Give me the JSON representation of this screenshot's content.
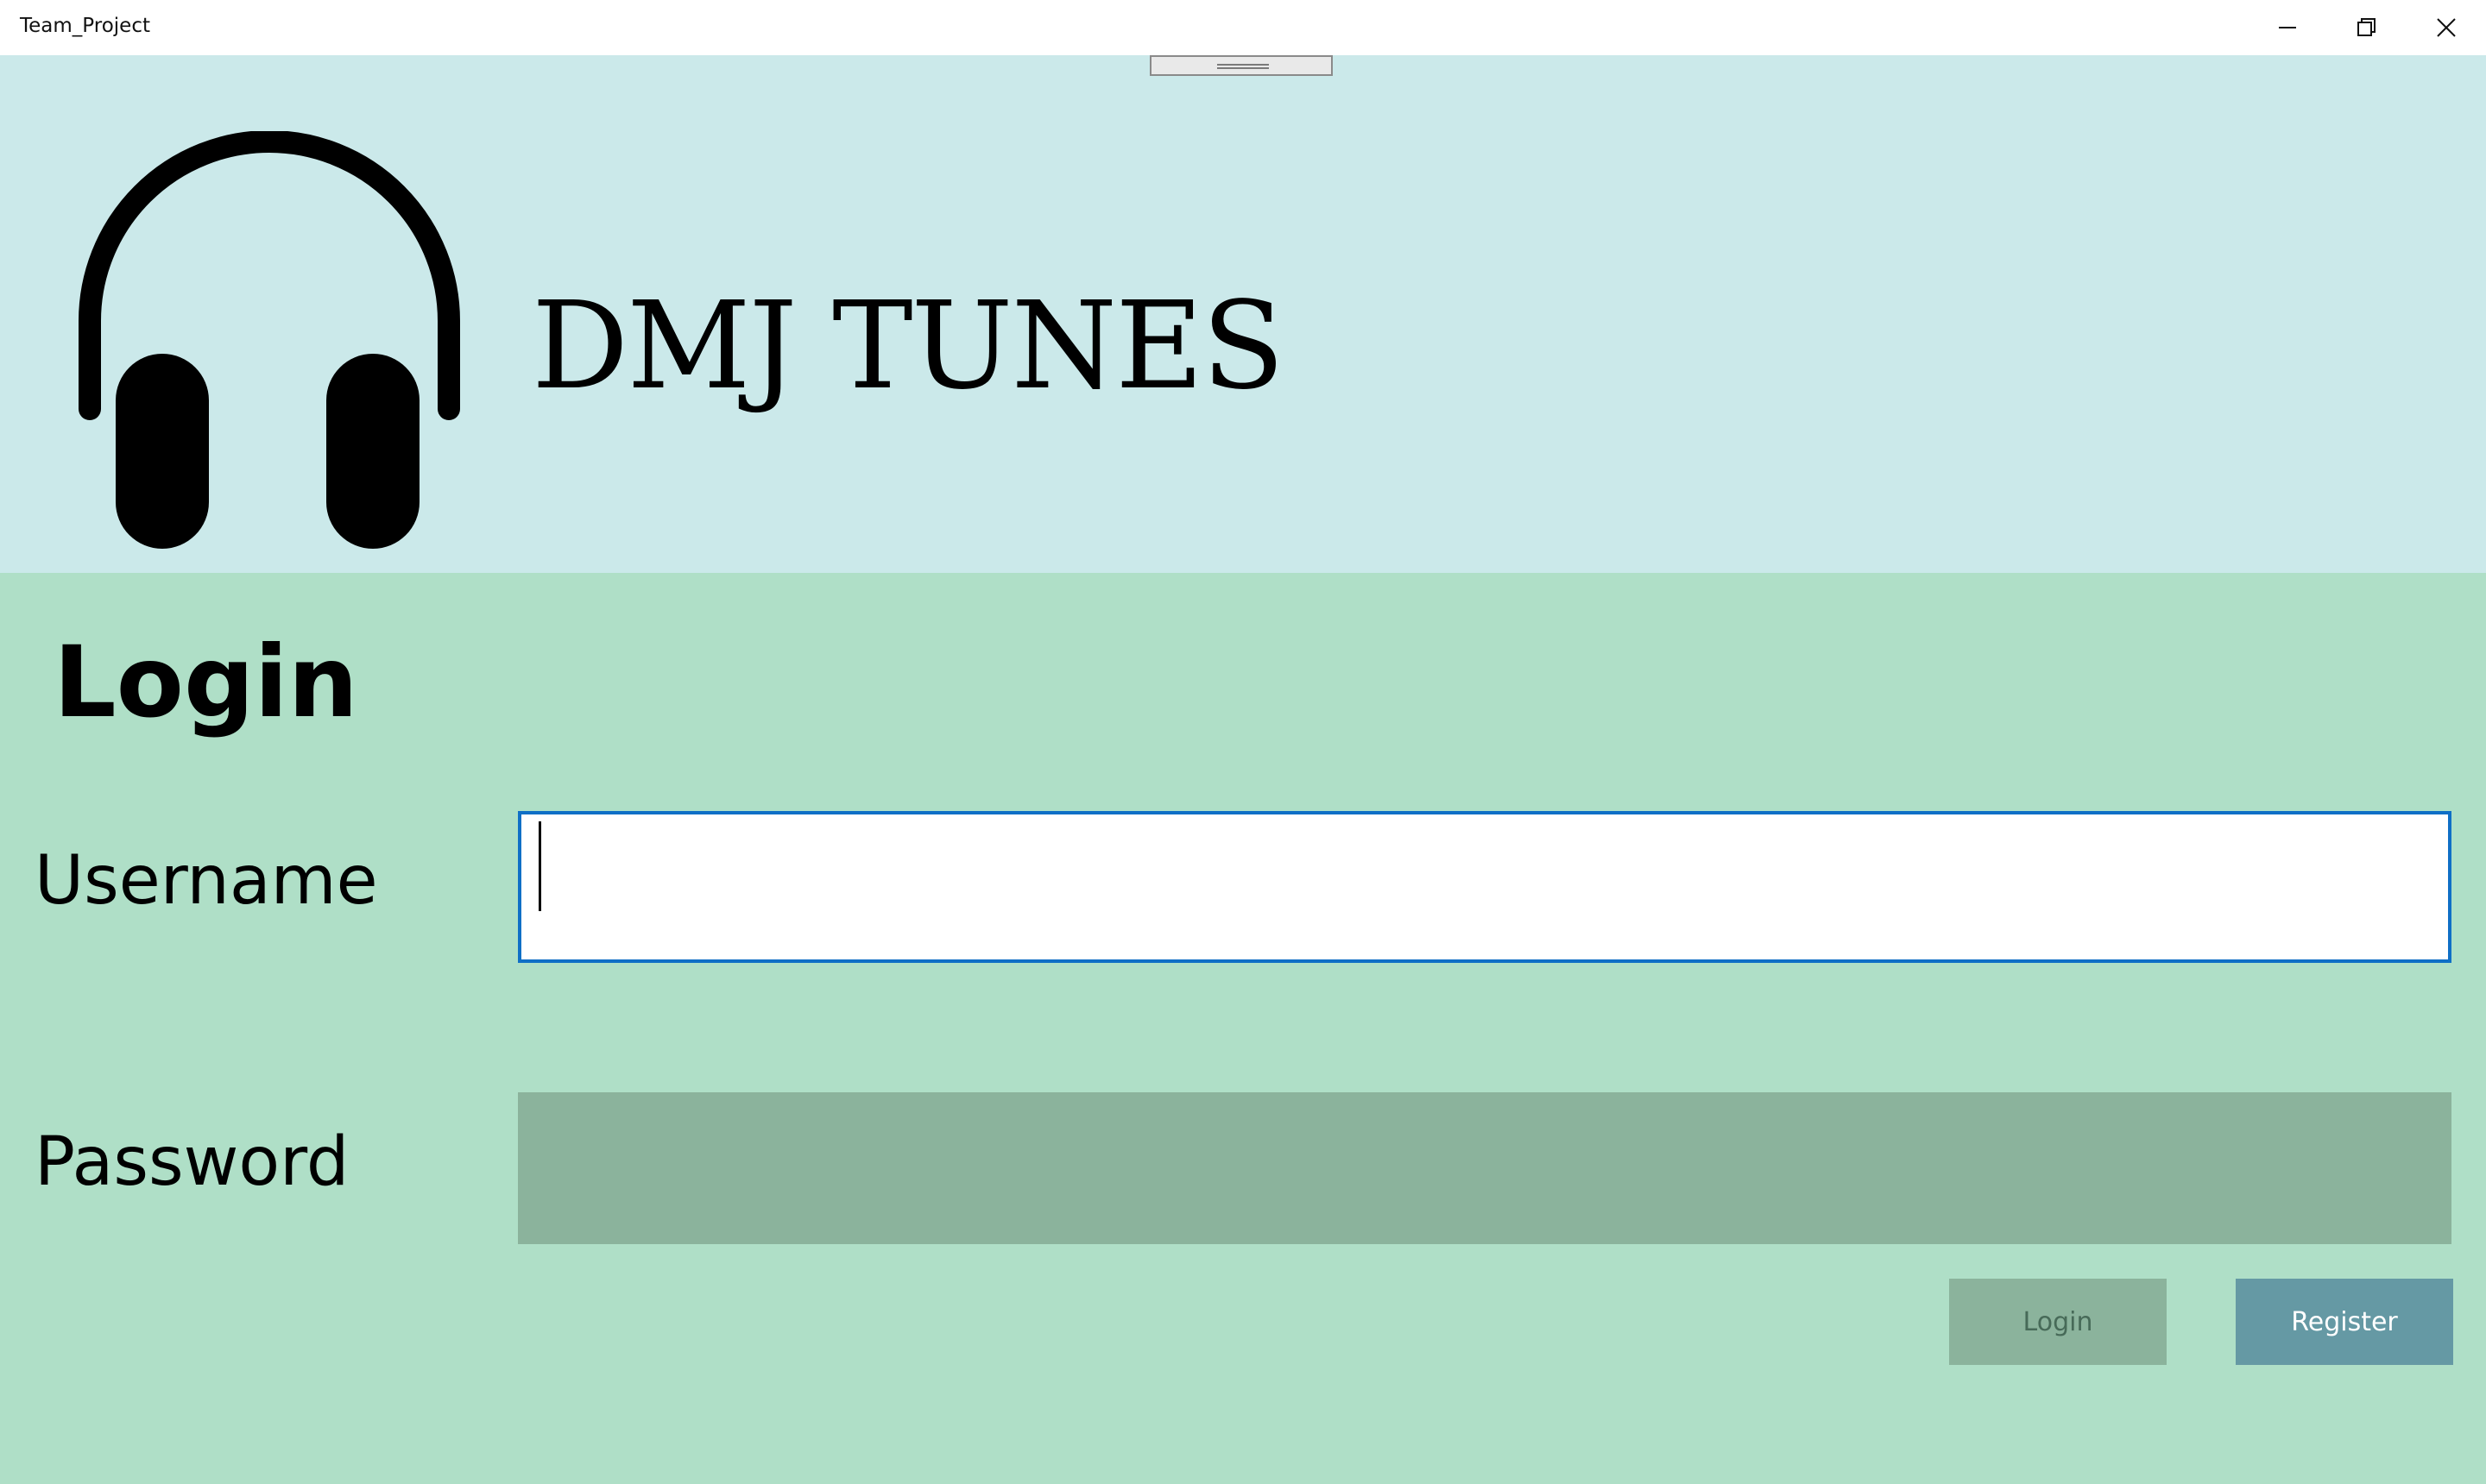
{
  "window": {
    "title": "Team_Project"
  },
  "header": {
    "brand": "DMJ TUNES",
    "logo_icon": "headphones-icon"
  },
  "login": {
    "heading": "Login",
    "username_label": "Username",
    "username_value": "",
    "password_label": "Password",
    "password_value": "",
    "login_button": "Login",
    "register_button": "Register"
  },
  "colors": {
    "header_bg": "#cbe9ea",
    "body_bg": "#afdfc7",
    "focus_border": "#0f6fc6",
    "password_bg": "#8bb39c",
    "register_bg": "#6599a4"
  }
}
